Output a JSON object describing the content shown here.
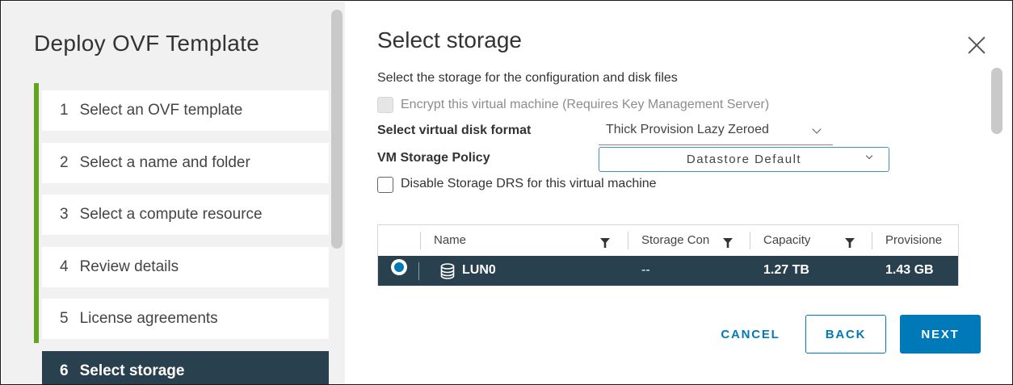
{
  "sidebar": {
    "title": "Deploy OVF Template",
    "steps": [
      {
        "num": "1",
        "label": "Select an OVF template"
      },
      {
        "num": "2",
        "label": "Select a name and folder"
      },
      {
        "num": "3",
        "label": "Select a compute resource"
      },
      {
        "num": "4",
        "label": "Review details"
      },
      {
        "num": "5",
        "label": "License agreements"
      },
      {
        "num": "6",
        "label": "Select storage"
      }
    ],
    "active_step": "6",
    "progress_color": "#62a420"
  },
  "main": {
    "title": "Select storage",
    "description": "Select the storage for the configuration and disk files",
    "encrypt_label": "Encrypt this virtual machine (Requires Key Management Server)",
    "encrypt_checked": false,
    "encrypt_disabled": true,
    "disk_format_label": "Select virtual disk format",
    "disk_format_value": "Thick Provision Lazy Zeroed",
    "storage_policy_label": "VM Storage Policy",
    "storage_policy_value": "Datastore Default",
    "disable_drs_label": "Disable Storage DRS for this virtual machine",
    "disable_drs_checked": false
  },
  "grid": {
    "columns": [
      "Name",
      "Storage Con",
      "Capacity",
      "Provisione"
    ],
    "rows": [
      {
        "name": "LUN0",
        "storage_compatibility": "--",
        "capacity": "1.27 TB",
        "provisioned": "1.43 GB",
        "selected": true
      }
    ]
  },
  "footer": {
    "cancel_label": "CANCEL",
    "back_label": "BACK",
    "next_label": "NEXT"
  },
  "icons": {
    "close": "close-icon",
    "filter": "filter-icon",
    "datastore": "datastore-icon",
    "dropdown": "chevron-down-icon"
  },
  "colors": {
    "accent": "#0079b8",
    "selected_row": "#29414e",
    "sidebar_bg": "#f1f1f1"
  }
}
